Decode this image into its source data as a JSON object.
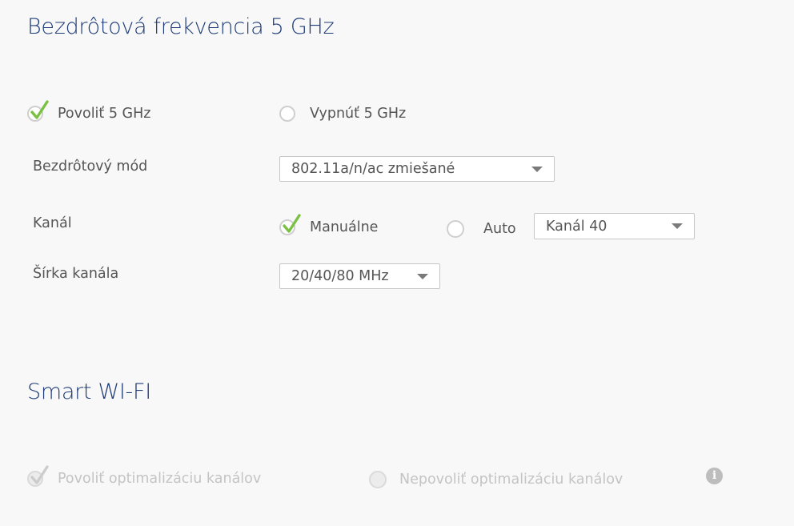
{
  "wifi5": {
    "title": "Bezdrôtová frekvencia 5 GHz",
    "enable_label": "Povoliť 5 GHz",
    "disable_label": "Vypnúť 5 GHz",
    "mode_label": "Bezdrôtový mód",
    "mode_value": "802.11a/n/ac zmiešané",
    "channel_label": "Kanál",
    "channel_manual_label": "Manuálne",
    "channel_auto_label": "Auto",
    "channel_value": "Kanál 40",
    "width_label": "Šírka kanála",
    "width_value": "20/40/80 MHz"
  },
  "smart": {
    "title": "Smart WI-FI",
    "enable_label": "Povoliť optimalizáciu kanálov",
    "disable_label": "Nepovoliť optimalizáciu kanálov",
    "info_glyph": "i"
  },
  "colors": {
    "title": "#1f3c78",
    "check": "#7ac143",
    "check_disabled": "#cccccc"
  }
}
